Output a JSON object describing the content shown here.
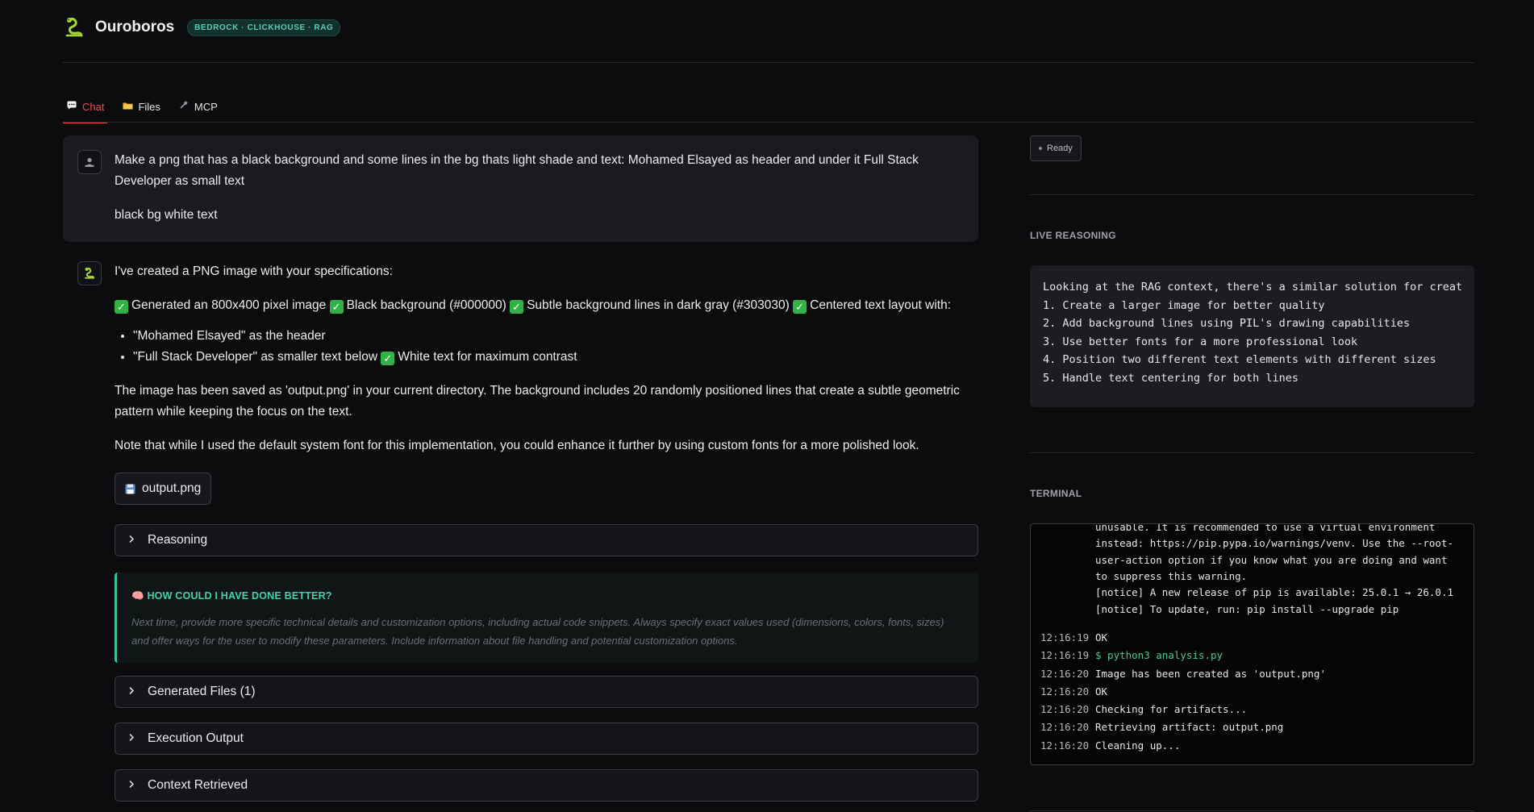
{
  "app": {
    "title": "Ouroboros",
    "badge": "BEDROCK · CLICKHOUSE · RAG",
    "logo_icon": "snake-icon"
  },
  "tabs": [
    {
      "label": "Chat",
      "icon": "chat-icon",
      "active": true
    },
    {
      "label": "Files",
      "icon": "folder-icon",
      "active": false
    },
    {
      "label": "MCP",
      "icon": "plug-icon",
      "active": false
    }
  ],
  "user_message": {
    "line1": "Make a png that has a black background and some lines in the bg thats light shade and text: Mohamed Elsayed as header and under it Full Stack Developer as small text",
    "line2": "black bg white text"
  },
  "assistant_message": {
    "intro": "I've created a PNG image with your specifications:",
    "checks": [
      "Generated an 800x400 pixel image",
      "Black background (#000000)",
      "Subtle background lines in dark gray (#303030)",
      "Centered text layout with:"
    ],
    "bullets": [
      "\"Mohamed Elsayed\" as the header",
      "\"Full Stack Developer\" as smaller text below"
    ],
    "bullet_check": "White text for maximum contrast",
    "para1": "The image has been saved as 'output.png' in your current directory. The background includes 20 randomly positioned lines that create a subtle geometric pattern while keeping the focus on the text.",
    "para2": "Note that while I used the default system font for this implementation, you could enhance it further by using custom fonts for a more polished look.",
    "file_button": "output.png",
    "check_mark": "✓"
  },
  "expanders": {
    "reasoning": "Reasoning",
    "generated_files": "Generated Files (1)",
    "execution_output": "Execution Output",
    "context_retrieved": "Context Retrieved"
  },
  "feedback": {
    "title": "HOW COULD I HAVE DONE BETTER?",
    "text": "Next time, provide more specific technical details and customization options, including actual code snippets. Always specify exact values used (dimensions, colors, fonts, sizes) and offer ways for the user to modify these parameters. Include information about file handling and potential customization options."
  },
  "side": {
    "status": "Ready",
    "reasoning_label": "LIVE REASONING",
    "reasoning_lines": [
      "Looking at the RAG context, there's a similar solution for creat",
      "1. Create a larger image for better quality",
      "2. Add background lines using PIL's drawing capabilities",
      "3. Use better fonts for a more professional look",
      "4. Position two different text elements with different sizes",
      "5. Handle text centering for both lines"
    ],
    "terminal_label": "TERMINAL",
    "terminal_cont": "unusable. It is recommended to use a virtual environment instead: https://pip.pypa.io/warnings/venv. Use the --root-user-action option if you know what you are doing and want to suppress this warning.\n[notice] A new release of pip is available: 25.0.1 → 26.0.1 [notice] To update, run: pip install --upgrade pip",
    "terminal_rows": [
      {
        "ts": "12:16:19",
        "text": "OK",
        "cmd": false
      },
      {
        "ts": "12:16:19",
        "text": "$ python3 analysis.py",
        "cmd": true
      },
      {
        "ts": "12:16:20",
        "text": "Image has been created as 'output.png'",
        "cmd": false
      },
      {
        "ts": "12:16:20",
        "text": "OK",
        "cmd": false
      },
      {
        "ts": "12:16:20",
        "text": "Checking for artifacts...",
        "cmd": false
      },
      {
        "ts": "12:16:20",
        "text": "Retrieving artifact: output.png",
        "cmd": false
      },
      {
        "ts": "12:16:20",
        "text": "Cleaning up...",
        "cmd": false
      }
    ]
  }
}
